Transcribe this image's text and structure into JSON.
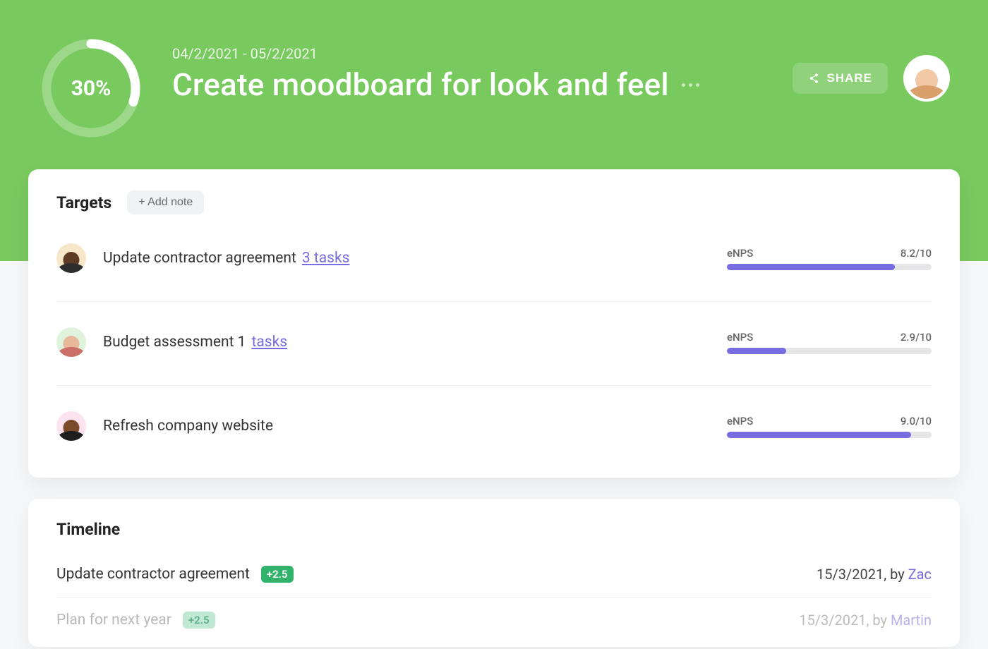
{
  "header": {
    "progress_pct_label": "30%",
    "progress_pct_value": 30,
    "date_range": "04/2/2021 - 05/2/2021",
    "title": "Create moodboard for look and feel",
    "share_label": "SHARE"
  },
  "targets": {
    "section_title": "Targets",
    "add_note_label": "+ Add note",
    "metric_label": "eNPS",
    "items": [
      {
        "title": "Update contractor agreement",
        "tasks_count_label": "3 tasks",
        "tasks_inline_prefix": "",
        "score_label": "8.2/10",
        "score_pct": 82,
        "avatar_bg": "#f7e7c9",
        "avatar_skin": "#5d3b24",
        "avatar_body": "#2d2d2d"
      },
      {
        "title": "Budget assessment 1",
        "tasks_count_label": "tasks",
        "tasks_inline_prefix": "",
        "score_label": "2.9/10",
        "score_pct": 29,
        "avatar_bg": "#dff3dc",
        "avatar_skin": "#e8b89a",
        "avatar_body": "#cc6f66"
      },
      {
        "title": "Refresh company website",
        "tasks_count_label": "",
        "tasks_inline_prefix": "",
        "score_label": "9.0/10",
        "score_pct": 90,
        "avatar_bg": "#fce3ef",
        "avatar_skin": "#7a4a2a",
        "avatar_body": "#1e1e1e"
      }
    ]
  },
  "timeline": {
    "section_title": "Timeline",
    "by_label": "by",
    "items": [
      {
        "title": "Update contractor agreement",
        "delta": "+2.5",
        "date": "15/3/2021",
        "author": "Zac",
        "faded": false
      },
      {
        "title": "Plan for next year",
        "delta": "+2.5",
        "date": "15/3/2021",
        "author": "Martin",
        "faded": true
      }
    ]
  }
}
